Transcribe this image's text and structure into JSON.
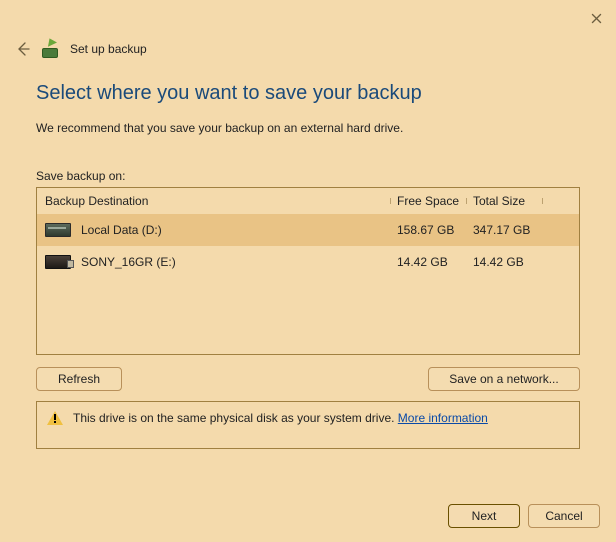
{
  "window": {
    "title": "Set up backup"
  },
  "heading": "Select where you want to save your backup",
  "recommend": "We recommend that you save your backup on an external hard drive.",
  "save_label": "Save backup on:",
  "columns": {
    "dest": "Backup Destination",
    "free": "Free Space",
    "total": "Total Size"
  },
  "drives": [
    {
      "name": "Local Data (D:)",
      "free": "158.67 GB",
      "total": "347.17 GB",
      "type": "internal",
      "selected": true
    },
    {
      "name": "SONY_16GR (E:)",
      "free": "14.42 GB",
      "total": "14.42 GB",
      "type": "usb",
      "selected": false
    }
  ],
  "buttons": {
    "refresh": "Refresh",
    "network": "Save on a network..."
  },
  "warning": {
    "text": "This drive is on the same physical disk as your system drive. ",
    "link": "More information"
  },
  "footer": {
    "next": "Next",
    "cancel": "Cancel"
  }
}
